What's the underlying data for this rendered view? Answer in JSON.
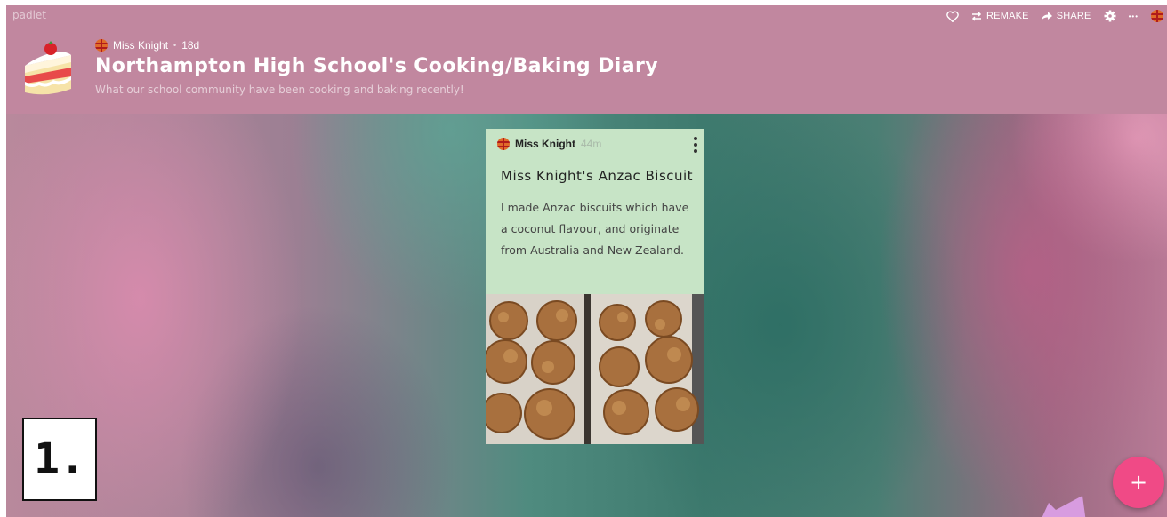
{
  "app": {
    "logo": "padlet"
  },
  "toolbar": {
    "remake_label": "REMAKE",
    "share_label": "SHARE",
    "more_label": "•••"
  },
  "board": {
    "author": "Miss Knight",
    "separator": "•",
    "age": "18d",
    "title": "Northampton High School's Cooking/Baking Diary",
    "subtitle": "What our school community have been cooking and baking recently!"
  },
  "post": {
    "author": "Miss Knight",
    "time": "44m",
    "title": "Miss Knight's Anzac Biscuit",
    "body": "I made Anzac biscuits which have a coconut flavour, and originate from Australia and New Zealand."
  },
  "annotation": {
    "step_label": "1."
  },
  "fab": {
    "label": "+"
  },
  "colors": {
    "header": "#c1879f",
    "post_bg": "#c7e4c6",
    "fab": "#f04a86",
    "arrow": "#d89ce0"
  },
  "icons": [
    "heart-icon",
    "remake-icon",
    "share-icon",
    "gear-icon",
    "more-icon",
    "user-avatar",
    "cake-icon",
    "post-menu-icon",
    "plus-icon"
  ]
}
